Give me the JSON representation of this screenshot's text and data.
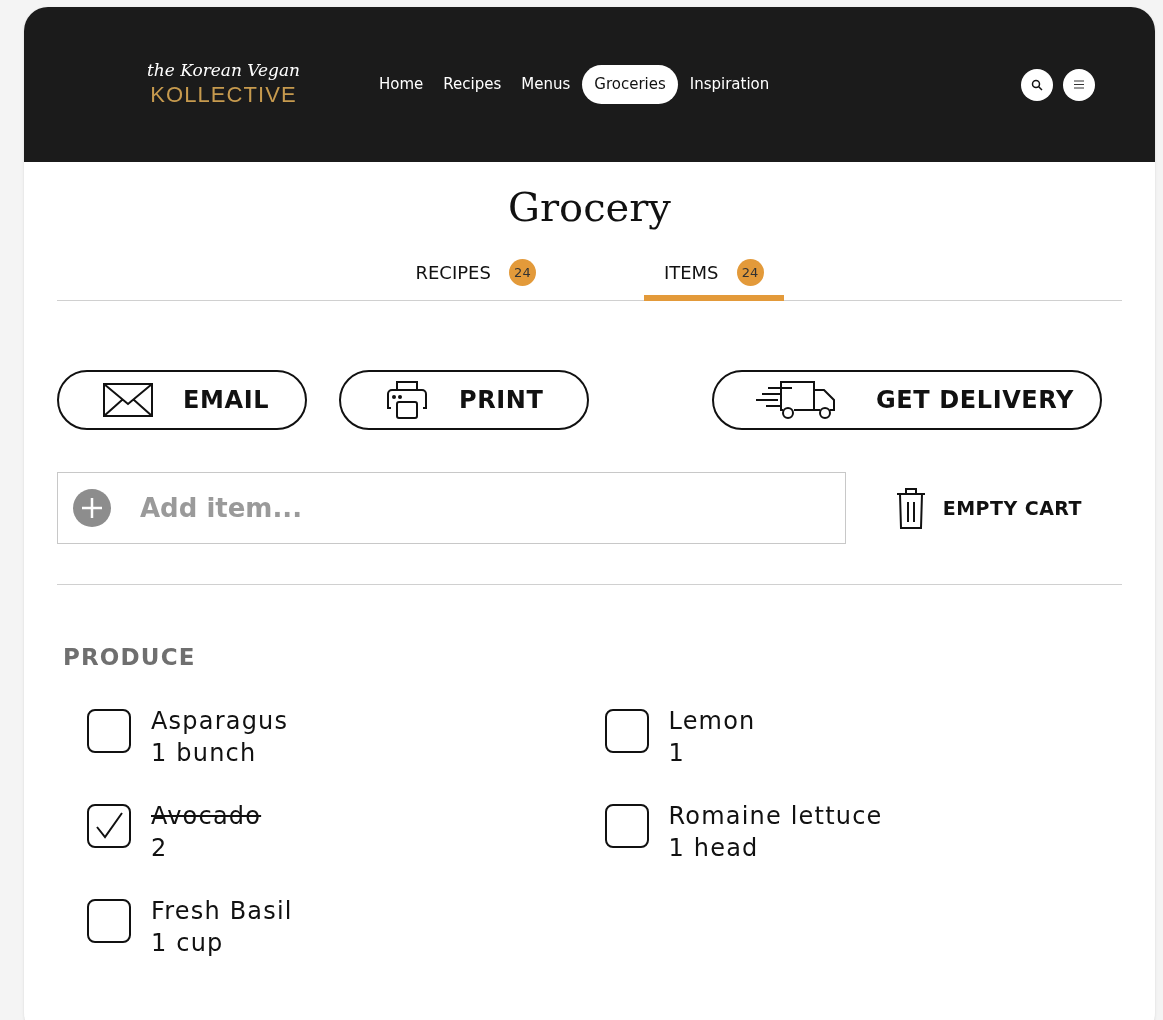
{
  "logo": {
    "line_1": "the Korean Vegan",
    "line_2": "KOLLECTIVE"
  },
  "nav": [
    {
      "label": "Home",
      "selected": false
    },
    {
      "label": "Recipes",
      "selected": false
    },
    {
      "label": "Menus",
      "selected": false
    },
    {
      "label": "Groceries",
      "selected": true
    },
    {
      "label": "Inspiration",
      "selected": false
    }
  ],
  "title": "Grocery",
  "tabs": [
    {
      "label": "RECIPES",
      "count": "24",
      "selected": false
    },
    {
      "label": "ITEMS",
      "count": "24",
      "selected": true
    }
  ],
  "actions": [
    {
      "kind": "email",
      "label": "EMAIL"
    },
    {
      "kind": "print",
      "label": "PRINT"
    },
    {
      "kind": "delivery",
      "label": "GET DELIVERY"
    }
  ],
  "add_item": {
    "placeholder": "Add item..."
  },
  "empty_cart": "EMPTY CART",
  "sections": [
    {
      "heading": "PRODUCE",
      "items": [
        {
          "name": "Asparagus",
          "quantity": "1 bunch",
          "checked": false
        },
        {
          "name": "Lemon",
          "quantity": "1",
          "checked": false
        },
        {
          "name": "Avocado",
          "quantity": "2",
          "checked": true
        },
        {
          "name": "Romaine lettuce",
          "quantity": "1 head",
          "checked": false
        },
        {
          "name": "Fresh Basil",
          "quantity": "1 cup",
          "checked": false
        }
      ]
    }
  ]
}
